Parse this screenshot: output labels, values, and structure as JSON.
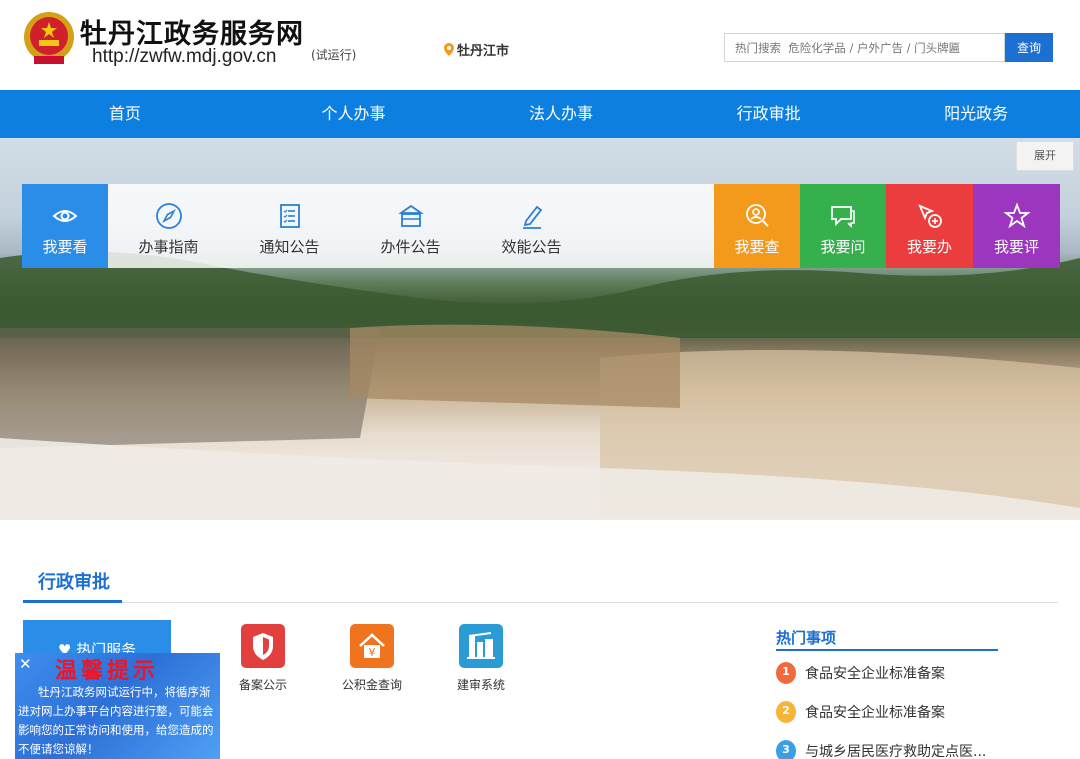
{
  "header": {
    "title": "牡丹江政务服务网",
    "url": "http://zwfw.mdj.gov.cn",
    "trial": "(试运行)",
    "location": "牡丹江市",
    "search_placeholder": "热门搜索  危险化学品 / 户外广告 / 门头牌匾",
    "search_button": "查询"
  },
  "nav": [
    "首页",
    "个人办事",
    "法人办事",
    "行政审批",
    "阳光政务"
  ],
  "banner": {
    "expand": "展开"
  },
  "quick": {
    "view": "我要看",
    "guide": "办事指南",
    "notice": "通知公告",
    "case": "办件公告",
    "perf": "效能公告",
    "check": "我要查",
    "ask": "我要问",
    "do": "我要办",
    "rate": "我要评"
  },
  "section": {
    "title": "行政审批",
    "hot_service": "♥ 热门服务",
    "apps": [
      "备案公示",
      "公积金查询",
      "建审系统"
    ]
  },
  "hot": {
    "title": "热门事项",
    "items": [
      "食品安全企业标准备案",
      "食品安全企业标准备案",
      "与城乡居民医疗救助定点医..."
    ],
    "ranks": [
      "1",
      "2",
      "3"
    ]
  },
  "notice": {
    "title": "温馨提示",
    "close": "✕",
    "body": "牡丹江政务网试运行中，将循序渐进对网上办事平台内容进行整，可能会影响您的正常访问和使用，给您造成的不便请您谅解！"
  },
  "colors": {
    "primary": "#0d7fe0",
    "orange": "#f39a1c",
    "green": "#36b04c",
    "red": "#eb3d3d",
    "purple": "#9c36be"
  }
}
